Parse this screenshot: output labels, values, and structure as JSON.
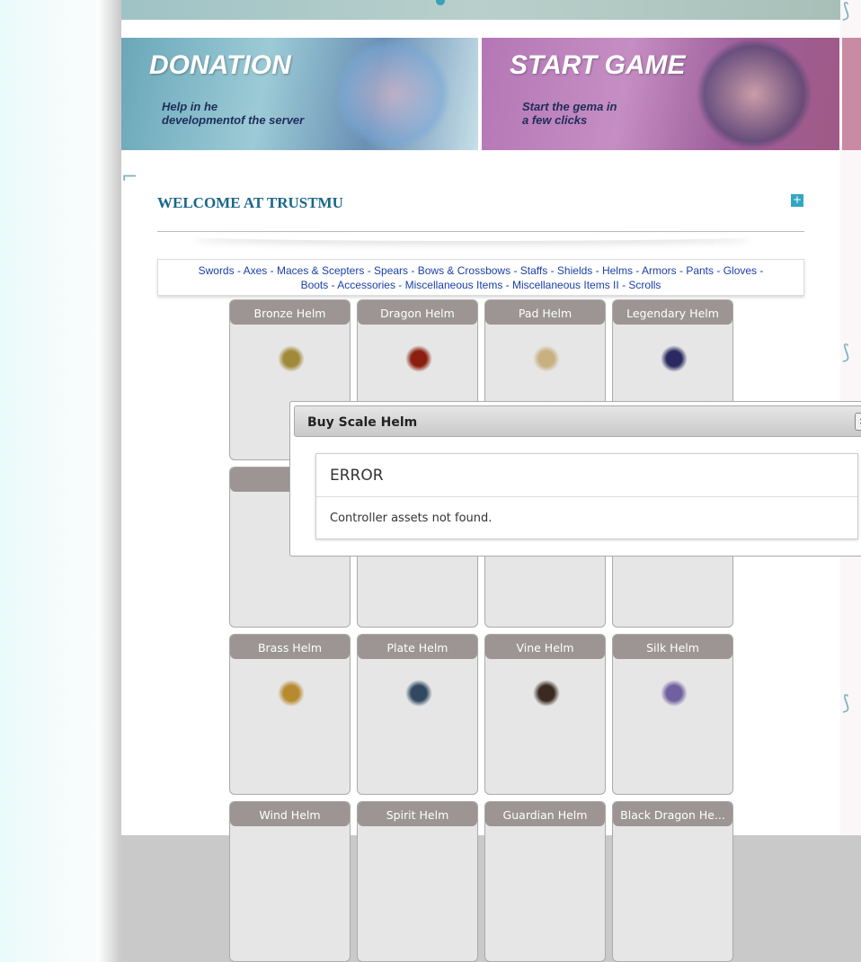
{
  "banners": [
    {
      "title": "DONATION",
      "subtitle_line1": "Help in he",
      "subtitle_line2": "developmentof the server"
    },
    {
      "title": "START GAME",
      "subtitle_line1": "Start the gema in",
      "subtitle_line2": "a few clicks"
    }
  ],
  "welcome": {
    "title": "WELCOME AT TRUSTMU",
    "expand_icon": "+"
  },
  "categories": [
    "Swords",
    "Axes",
    "Maces & Scepters",
    "Spears",
    "Bows & Crossbows",
    "Staffs",
    "Shields",
    "Helms",
    "Armors",
    "Pants",
    "Gloves",
    "Boots",
    "Accessories",
    "Miscellaneous Items",
    "Miscellaneous Items II",
    "Scrolls"
  ],
  "items": {
    "row1": [
      "Bronze Helm",
      "Dragon Helm",
      "Pad Helm",
      "Legendary Helm"
    ],
    "row3": [
      "Brass Helm",
      "Plate Helm",
      "Vine Helm",
      "Silk Helm"
    ],
    "row4": [
      "Wind Helm",
      "Spirit Helm",
      "Guardian Helm",
      "Black Dragon He..."
    ]
  },
  "modal": {
    "title": "Buy Scale Helm",
    "close_icon": "✖",
    "error_title": "ERROR",
    "error_message": "Controller assets not found."
  },
  "colors": {
    "accent": "#19678a",
    "link": "#1a3fa8",
    "card_header": "#9c9594"
  }
}
